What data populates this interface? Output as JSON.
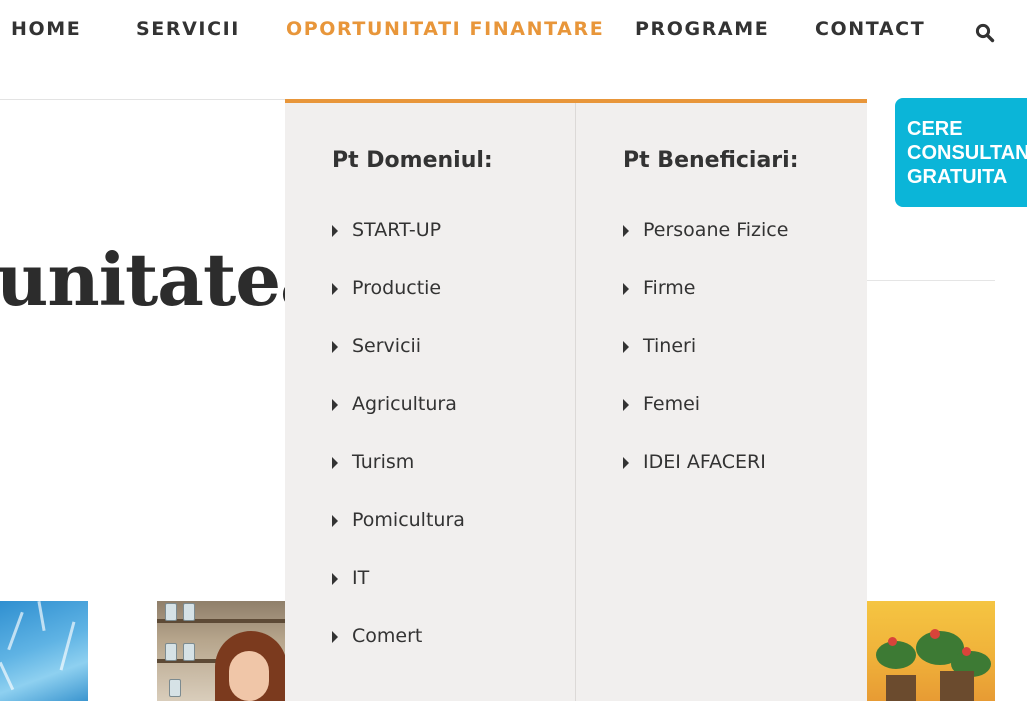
{
  "nav": {
    "items": [
      {
        "label": "HOME",
        "active": false
      },
      {
        "label": "SERVICII",
        "active": false
      },
      {
        "label": "OPORTUNITATI FINANTARE",
        "active": true
      },
      {
        "label": "PROGRAME",
        "active": false
      },
      {
        "label": "CONTACT",
        "active": false
      }
    ],
    "search_icon": "search-icon"
  },
  "hero": {
    "title_fragment": "unitatea"
  },
  "mega_menu": {
    "accent_color": "#e8963a",
    "background_color": "#f1efee",
    "columns": [
      {
        "heading": "Pt Domeniul:",
        "items": [
          "START-UP",
          "Productie",
          "Servicii",
          "Agricultura",
          "Turism",
          "Pomicultura",
          "IT",
          "Comert"
        ]
      },
      {
        "heading": "Pt Beneficiari:",
        "items": [
          "Persoane Fizice",
          "Firme",
          "Tineri",
          "Femei",
          "IDEI AFACERI"
        ]
      }
    ]
  },
  "cta": {
    "lines": [
      "CERE",
      "CONSULTANTA",
      "GRATUITA"
    ],
    "color": "#0bb5d8"
  }
}
